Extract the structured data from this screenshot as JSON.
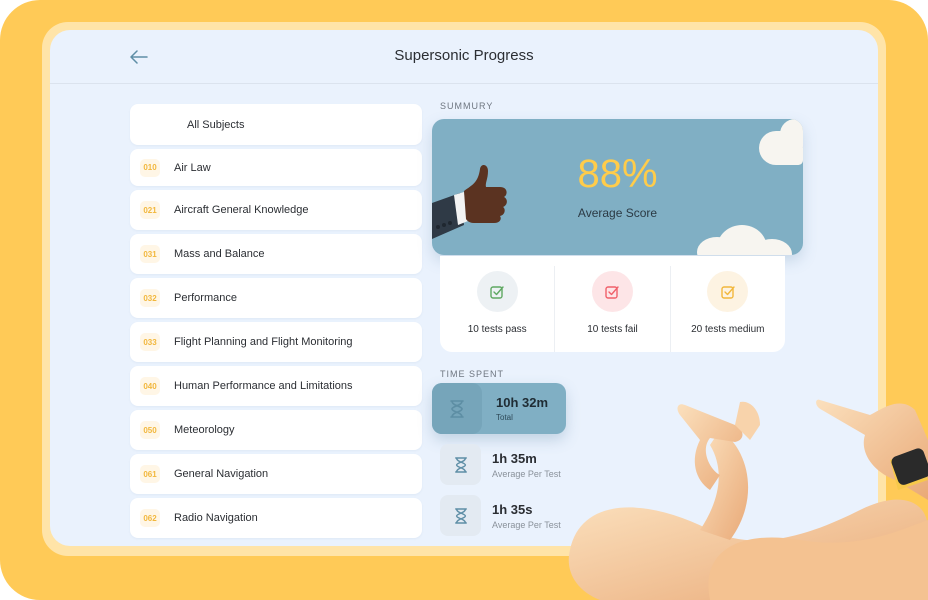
{
  "header": {
    "title": "Supersonic Progress",
    "back_icon": "arrow-left-icon"
  },
  "subjects": {
    "all_label": "All Subjects",
    "items": [
      {
        "code": "010",
        "name": "Air Law"
      },
      {
        "code": "021",
        "name": "Aircraft General Knowledge"
      },
      {
        "code": "031",
        "name": "Mass and Balance"
      },
      {
        "code": "032",
        "name": "Performance"
      },
      {
        "code": "033",
        "name": "Flight Planning and Flight Monitoring"
      },
      {
        "code": "040",
        "name": "Human Performance and Limitations"
      },
      {
        "code": "050",
        "name": "Meteorology"
      },
      {
        "code": "061",
        "name": "General Navigation"
      },
      {
        "code": "062",
        "name": "Radio Navigation"
      }
    ]
  },
  "summary": {
    "section_label": "SUMMURY",
    "score": "88%",
    "score_label": "Average Score",
    "stats": [
      {
        "label": "10 tests pass",
        "icon": "checkbox-icon",
        "color": "#5fa862",
        "bg": "#edf1f4"
      },
      {
        "label": "10 tests fail",
        "icon": "checkbox-icon",
        "color": "#f0606a",
        "bg": "#fde5e7"
      },
      {
        "label": "20 tests medium",
        "icon": "checkbox-icon",
        "color": "#f2b73c",
        "bg": "#fdf3e2"
      }
    ]
  },
  "time_spent": {
    "section_label": "TIME SPENT",
    "items": [
      {
        "value": "10h 32m",
        "label": "Total",
        "icon": "hourglass-icon"
      },
      {
        "value": "1h 35m",
        "label": "Average Per Test",
        "icon": "hourglass-icon"
      },
      {
        "value": "1h 35s",
        "label": "Average Per Test",
        "icon": "hourglass-icon"
      }
    ]
  },
  "colors": {
    "frame": "#ffca57",
    "accent_blue": "#80afc4",
    "accent_yellow": "#ffcc4a",
    "background": "#eaf2fd"
  }
}
